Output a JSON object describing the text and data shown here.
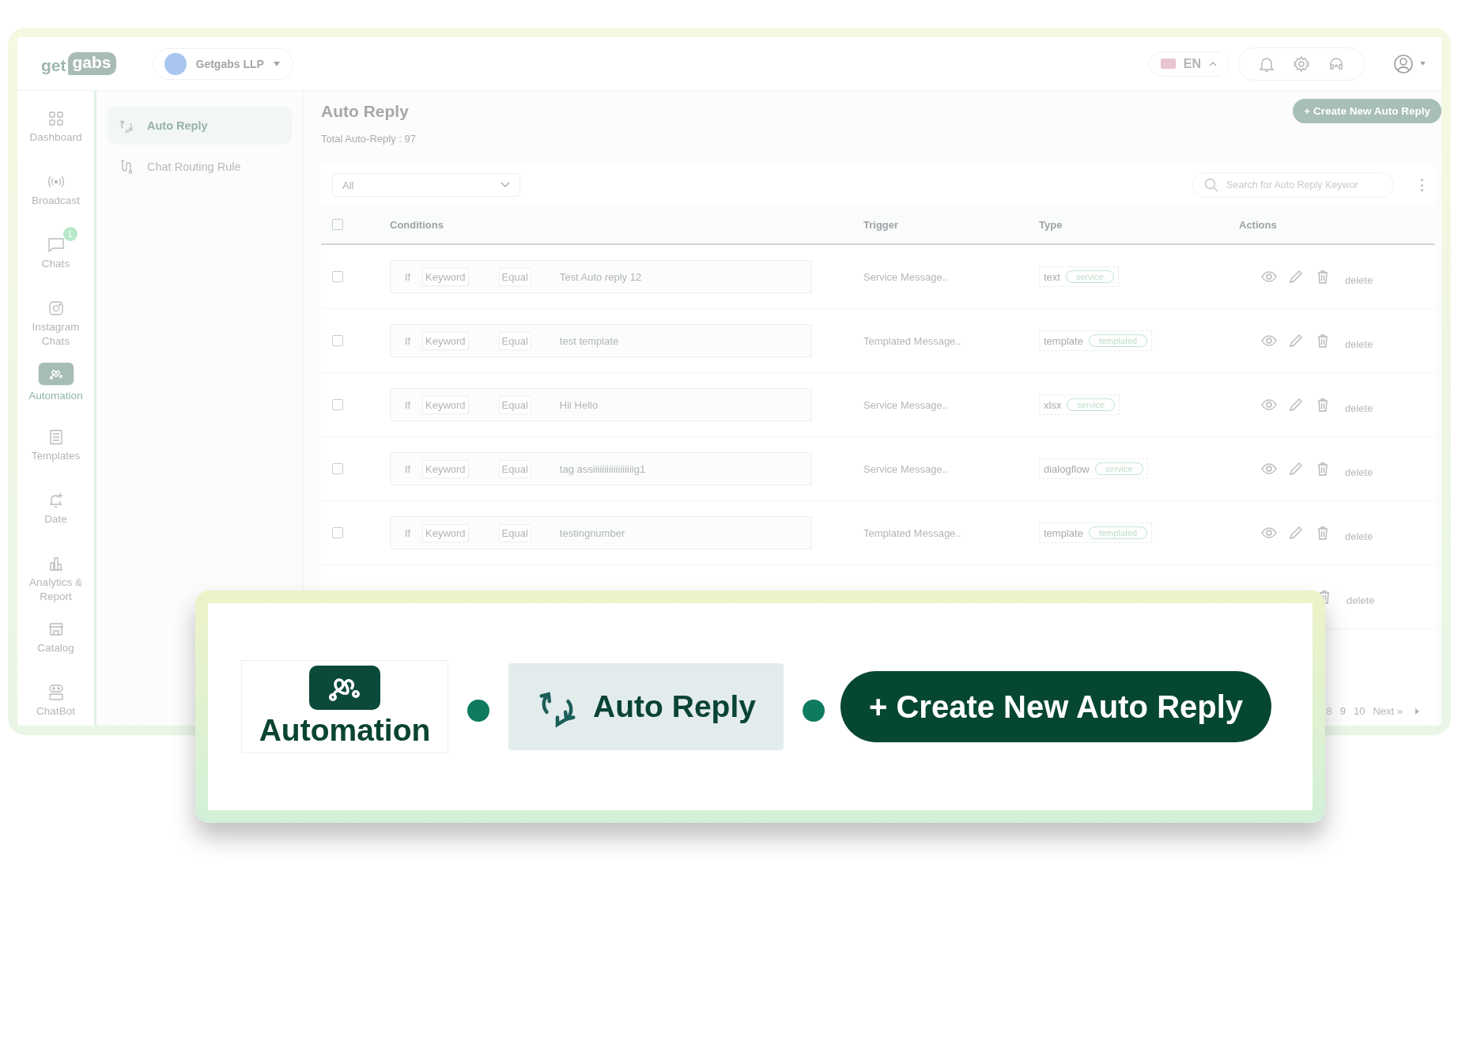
{
  "logo": {
    "text_1": "get",
    "text_2": "gabs"
  },
  "workspace": {
    "name": "Getgabs LLP"
  },
  "language": {
    "code": "EN"
  },
  "nav": [
    {
      "label": "Dashboard",
      "selected": false
    },
    {
      "label": "Broadcast",
      "selected": false
    },
    {
      "label": "Chats",
      "selected": false,
      "badge": "1"
    },
    {
      "label": "Instagram Chats",
      "selected": false
    },
    {
      "label": "Automation",
      "selected": true
    },
    {
      "label": "Templates",
      "selected": false
    },
    {
      "label": "Date",
      "selected": false
    },
    {
      "label": "Analytics & Report",
      "selected": false
    },
    {
      "label": "Catalog",
      "selected": false
    },
    {
      "label": "ChatBot",
      "selected": false
    }
  ],
  "submenu": [
    {
      "label": "Auto Reply",
      "selected": true
    },
    {
      "label": "Chat Routing Rule",
      "selected": false
    }
  ],
  "page": {
    "title": "Auto Reply",
    "total": "Total Auto-Reply : 97",
    "create_button": "+ Create New Auto Reply"
  },
  "filter": {
    "value": "All"
  },
  "search": {
    "placeholder": "Search for Auto Reply Keywor"
  },
  "table": {
    "select_all": {
      "checked": false
    },
    "columns": [
      "Conditions",
      "Trigger",
      "Type",
      "Actions"
    ],
    "rows": [
      {
        "kind": "full",
        "checked": false,
        "if": "If",
        "field": "Keyword",
        "operator": "Equal",
        "value": "Test Auto reply 12",
        "trigger": "Service Message..",
        "type": "text",
        "tag": "service",
        "action": "delete"
      },
      {
        "kind": "full",
        "checked": false,
        "if": "If",
        "field": "Keyword",
        "operator": "Equal",
        "value": "test template",
        "trigger": "Templated Message..",
        "type": "template",
        "tag": "templated",
        "action": "delete"
      },
      {
        "kind": "full",
        "checked": false,
        "if": "If",
        "field": "Keyword",
        "operator": "Equal",
        "value": "Hii Hello",
        "trigger": "Service Message..",
        "type": "xlsx",
        "tag": "service",
        "action": "delete"
      },
      {
        "kind": "full",
        "checked": false,
        "if": "If",
        "field": "Keyword",
        "operator": "Equal",
        "value": "tag assiiiiiiiiiiiiiiiiiig1",
        "trigger": "Service Message..",
        "type": "dialogflow",
        "tag": "service",
        "action": "delete"
      },
      {
        "kind": "full",
        "checked": false,
        "if": "If",
        "field": "Keyword",
        "operator": "Equal",
        "value": "testingnumber",
        "trigger": "Templated Message..",
        "type": "template",
        "tag": "templated",
        "action": "delete"
      },
      {
        "kind": "partial",
        "action": "delete"
      }
    ]
  },
  "pagination": [
    "8",
    "9",
    "10",
    "Next »"
  ],
  "callout": {
    "items": [
      {
        "kind": "nav_item",
        "label": "Automation"
      },
      {
        "kind": "menu_item",
        "label": "Auto Reply"
      },
      {
        "kind": "button",
        "label": "+ Create New Auto Reply"
      }
    ]
  }
}
